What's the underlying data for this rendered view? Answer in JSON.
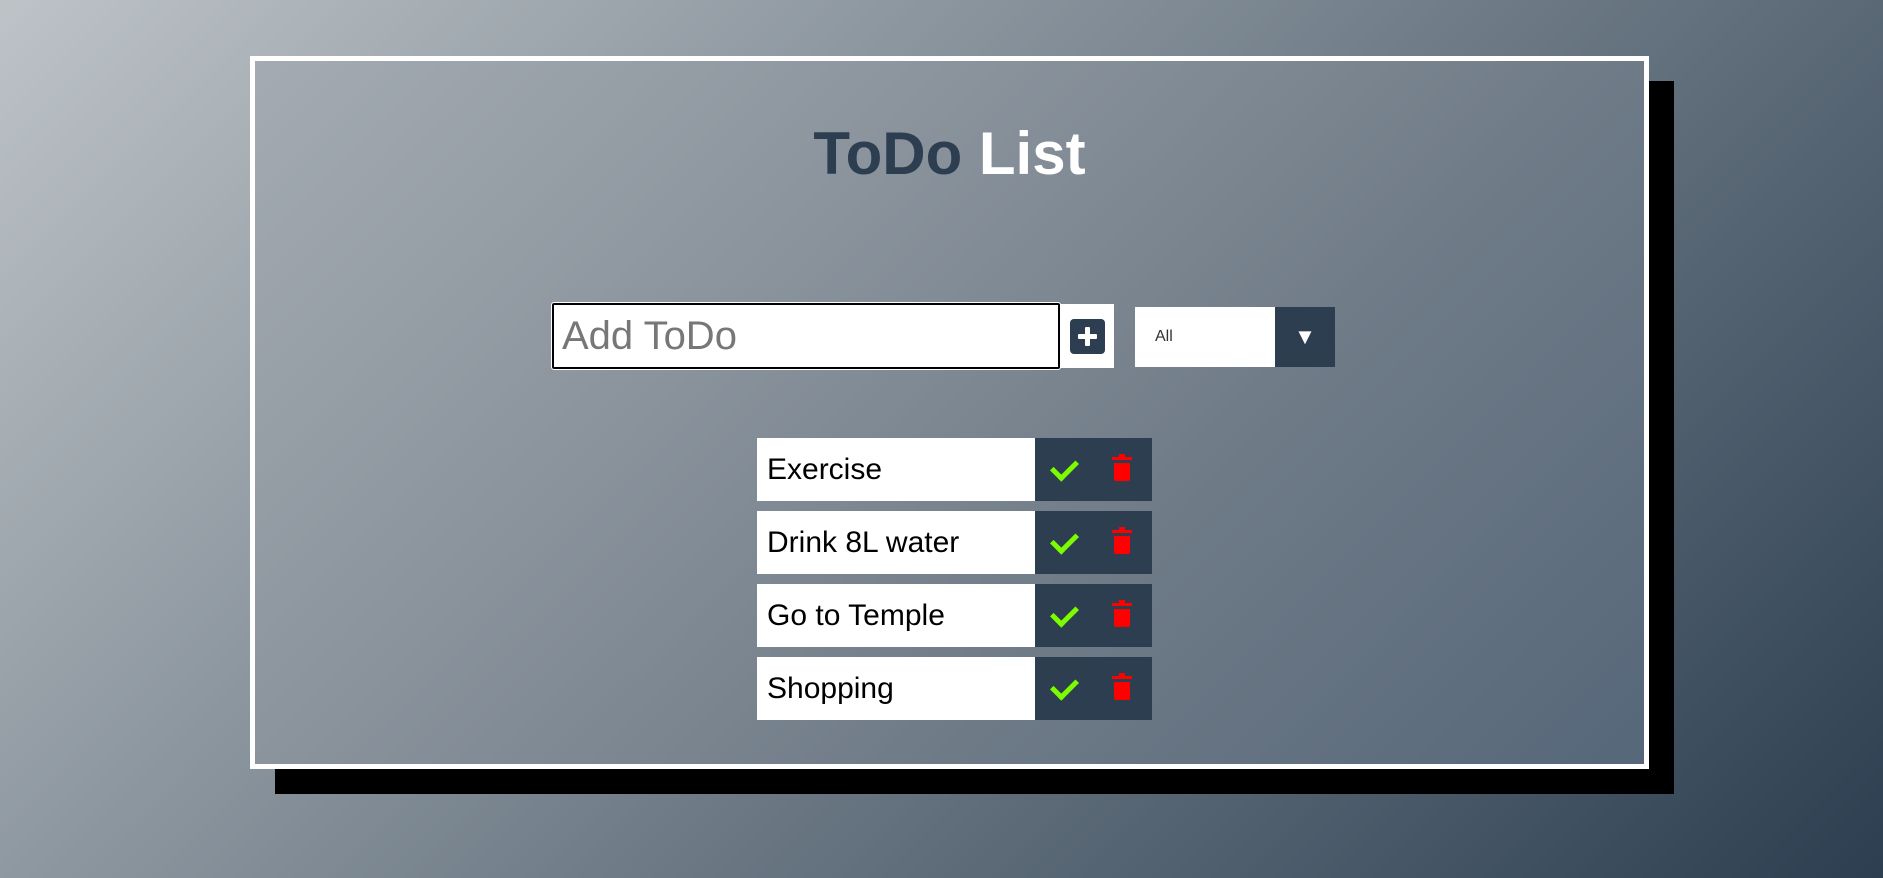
{
  "app": {
    "title_dark": "ToDo",
    "title_light": "List"
  },
  "add_form": {
    "input_value": "",
    "input_placeholder": "Add ToDo",
    "add_button_icon": "plus-square-icon"
  },
  "filter": {
    "selected": "All",
    "arrow_glyph": "▼"
  },
  "todos": [
    {
      "text": "Exercise"
    },
    {
      "text": "Drink 8L water"
    },
    {
      "text": "Go to Temple"
    },
    {
      "text": "Shopping"
    }
  ],
  "icons": {
    "complete": "check-icon",
    "delete": "trash-icon"
  },
  "colors": {
    "accent_dark": "#2c3e50",
    "check_green": "#7cfc00",
    "trash_red": "#ff0000",
    "frame_border": "#ffffff"
  }
}
